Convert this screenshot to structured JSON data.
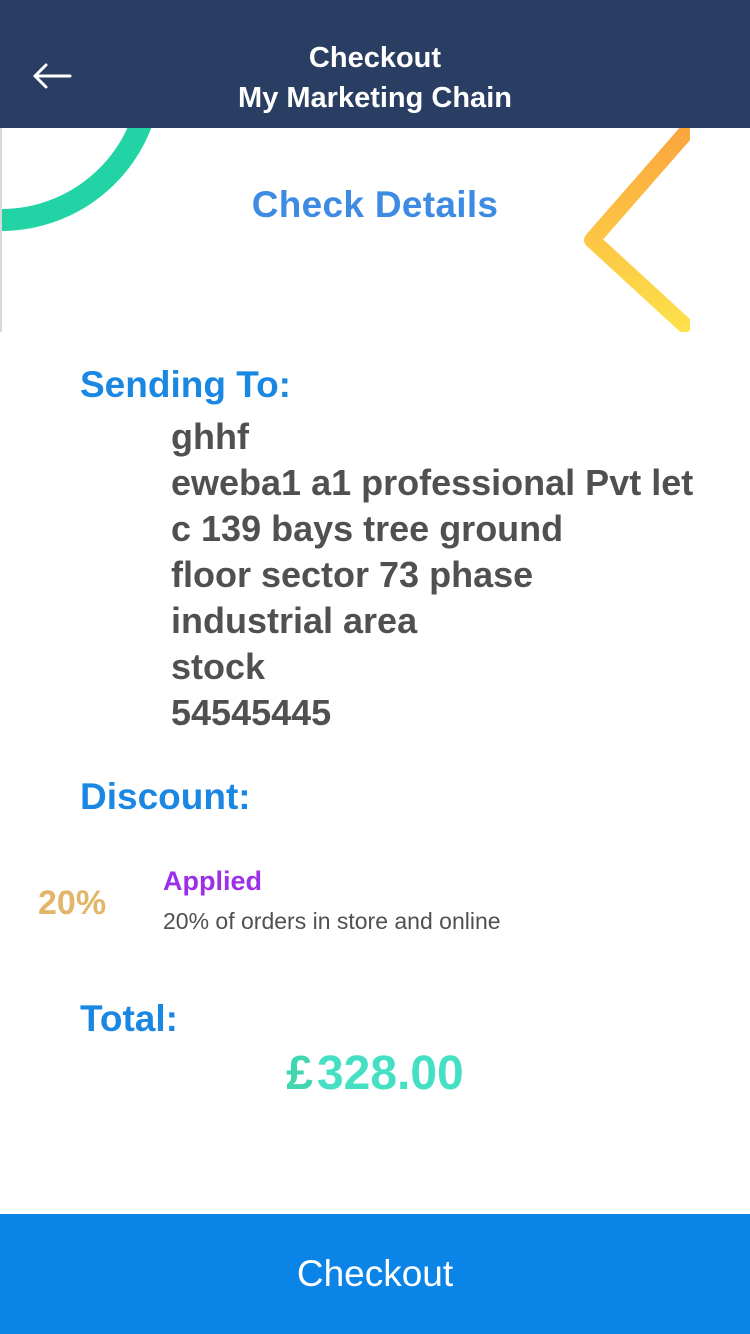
{
  "header": {
    "title": "Checkout",
    "subtitle": "My Marketing Chain",
    "back_icon": "arrow-left-icon"
  },
  "banner": {
    "title": "Check Details"
  },
  "sending_to": {
    "heading": "Sending To:",
    "lines": [
      "ghhf",
      "eweba1 a1 professional Pvt let",
      "c 139 bays tree ground",
      "floor sector 73 phase",
      "industrial area",
      "stock",
      "54545445"
    ]
  },
  "discount": {
    "heading": "Discount:",
    "percent": "20%",
    "status": "Applied",
    "description": "20% of orders in store and online"
  },
  "total": {
    "heading": "Total:",
    "currency": "£",
    "amount": "328.00"
  },
  "checkout_button": {
    "label": "Checkout"
  },
  "colors": {
    "header_bg": "#2a3e63",
    "heading_blue": "#1a87e3",
    "banner_title": "#3d8be3",
    "discount_percent": "#e1b66a",
    "applied_purple": "#9b30e8",
    "total_teal": "#45e0c3",
    "button_blue": "#0a84e6"
  }
}
